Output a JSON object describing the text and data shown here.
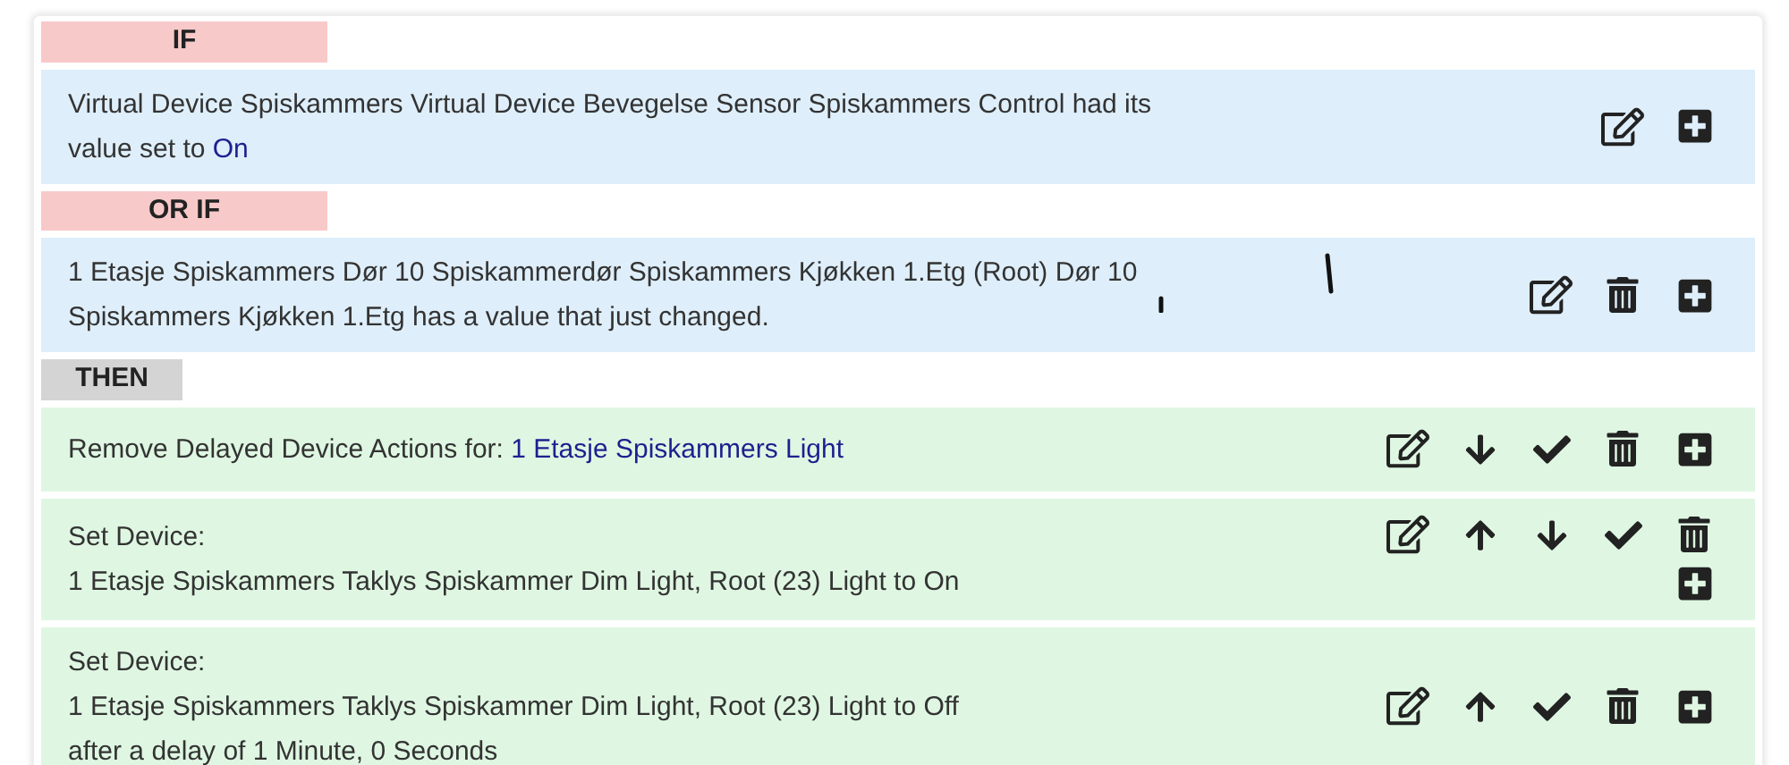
{
  "blocks": [
    {
      "kind": "if_header",
      "label": "IF"
    },
    {
      "kind": "condition",
      "lines": [
        [
          {
            "kind": "plain",
            "text": "Virtual Device Spiskammers Virtual Device Bevegelse Sensor Spiskammers Control had its"
          }
        ],
        [
          {
            "kind": "plain",
            "text": "value set to "
          },
          {
            "kind": "value",
            "text": "On"
          }
        ]
      ],
      "actions": [
        {
          "kind": "edit"
        },
        {
          "kind": "add"
        }
      ]
    },
    {
      "kind": "if_header",
      "label": "OR IF"
    },
    {
      "kind": "condition",
      "lines": [
        [
          {
            "kind": "plain",
            "text": "1 Etasje Spiskammers Dør 10 Spiskammerdør Spiskammers Kjøkken 1.Etg (Root) Dør 10"
          }
        ],
        [
          {
            "kind": "plain",
            "text": "Spiskammers Kjøkken 1.Etg has a value that just changed."
          }
        ]
      ],
      "actions": [
        {
          "kind": "edit"
        },
        {
          "kind": "delete"
        },
        {
          "kind": "add"
        }
      ],
      "pen_marks": true
    },
    {
      "kind": "then_header",
      "label": "THEN"
    },
    {
      "kind": "action",
      "lines": [
        [
          {
            "kind": "plain",
            "text": "Remove Delayed Device Actions for: "
          },
          {
            "kind": "value",
            "text": "1 Etasje Spiskammers Light"
          }
        ]
      ],
      "actions": [
        {
          "kind": "edit"
        },
        {
          "kind": "down"
        },
        {
          "kind": "check"
        },
        {
          "kind": "delete"
        },
        {
          "kind": "add"
        }
      ]
    },
    {
      "kind": "action",
      "lines": [
        [
          {
            "kind": "plain",
            "text": "Set Device:"
          }
        ],
        [
          {
            "kind": "plain",
            "text": "1 Etasje Spiskammers Taklys Spiskammer Dim Light, Root (23) Light to On"
          }
        ]
      ],
      "actions": [
        {
          "kind": "edit"
        },
        {
          "kind": "up"
        },
        {
          "kind": "down"
        },
        {
          "kind": "check"
        },
        {
          "kind": "delete"
        },
        {
          "kind": "add"
        }
      ]
    },
    {
      "kind": "action",
      "lines": [
        [
          {
            "kind": "plain",
            "text": "Set Device:"
          }
        ],
        [
          {
            "kind": "plain",
            "text": "1 Etasje Spiskammers Taklys Spiskammer Dim Light, Root (23) Light to Off"
          }
        ],
        [
          {
            "kind": "plain",
            "text": "after a delay of 1 Minute, 0 Seconds"
          }
        ]
      ],
      "actions": [
        {
          "kind": "edit"
        },
        {
          "kind": "up"
        },
        {
          "kind": "check"
        },
        {
          "kind": "delete"
        },
        {
          "kind": "add"
        }
      ]
    }
  ]
}
